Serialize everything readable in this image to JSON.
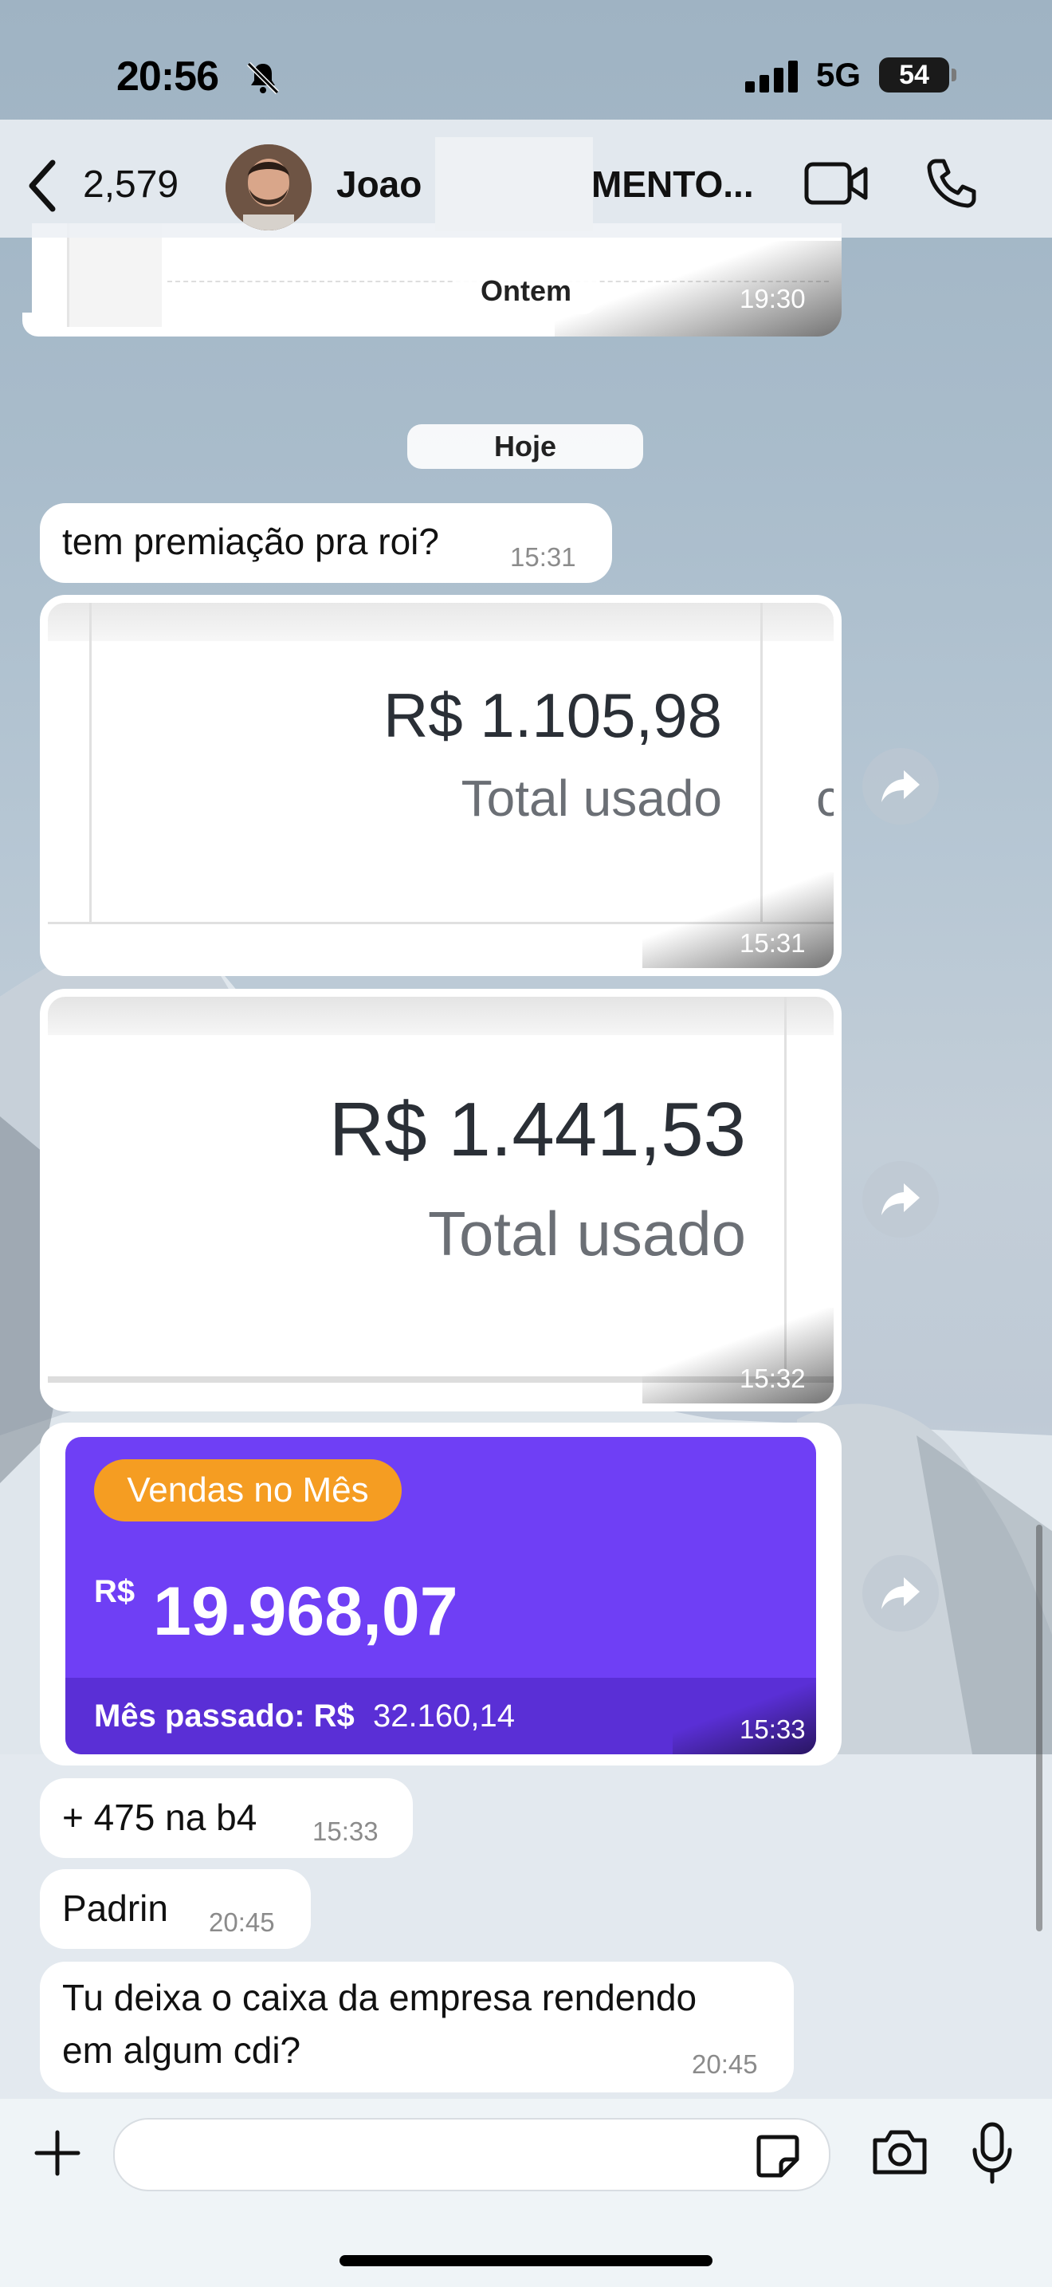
{
  "status_bar": {
    "time": "20:56",
    "network": "5G",
    "battery": "54"
  },
  "header": {
    "back_count": "2,579",
    "contact_first": "Joao",
    "contact_rest": "MENTO..."
  },
  "date_pills": {
    "yesterday": "Ontem",
    "today": "Hoje"
  },
  "messages": {
    "prev_image_time": "19:30",
    "m1": {
      "text": "tem premiação pra roi?",
      "time": "15:31"
    },
    "img1": {
      "amount": "R$ 1.105,98",
      "label": "Total usado",
      "partial": "c",
      "time": "15:31"
    },
    "img2": {
      "amount": "R$ 1.441,53",
      "label": "Total usado",
      "time": "15:32"
    },
    "img3": {
      "badge": "Vendas no Mês",
      "currency": "R$",
      "amount": "19.968,07",
      "last_month_label": "Mês passado: R$",
      "last_month_value": "32.160,14",
      "time": "15:33"
    },
    "m2": {
      "text": "+ 475 na b4",
      "time": "15:33"
    },
    "m3": {
      "text": "Padrin",
      "time": "20:45"
    },
    "m4": {
      "line1": "Tu deixa o caixa da empresa rendendo",
      "line2": "em algum cdi?",
      "time": "20:45"
    }
  },
  "colors": {
    "purple": "#6f3ff5",
    "badge": "#f59d22",
    "bubble": "#ffffff"
  }
}
